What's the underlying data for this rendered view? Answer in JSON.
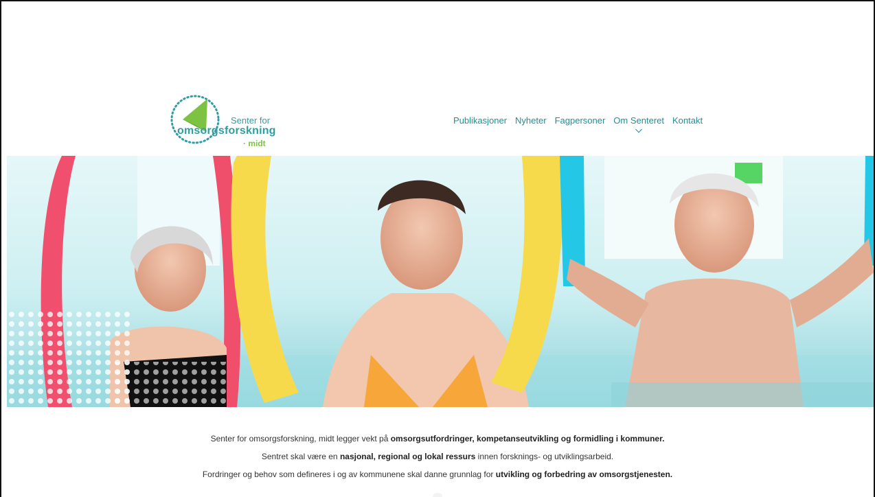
{
  "logo": {
    "line1": "Senter for",
    "line2": "omsorgsforskning",
    "line3": "· midt",
    "icon": "green-kite-dotted-circle-logo"
  },
  "nav": {
    "items": [
      {
        "label": "Publikasjoner"
      },
      {
        "label": "Nyheter"
      },
      {
        "label": "Fagpersoner"
      },
      {
        "label": "Om Senteret"
      },
      {
        "label": "Kontakt"
      }
    ],
    "dropdown_icon": "chevron-down-icon"
  },
  "hero": {
    "image": "three people holding pool noodles in a swimming pool"
  },
  "intro": {
    "line1_pre": "Senter for omsorgsforskning, midt legger vekt på ",
    "line1_bold": "omsorgsutfordringer, kompetanseutvikling og formidling i kommuner.",
    "line2_pre": "Sentret skal være en ",
    "line2_bold": "nasjonal, regional og lokal ressurs",
    "line2_post": " innen forsknings- og utviklingsarbeid.",
    "line3_pre": "Fordringer og behov som defineres i og av kommunene skal danne grunnlag for ",
    "line3_bold": "utvikling og forbedring av omsorgstjenesten."
  },
  "colors": {
    "brand_teal": "#2f9ea3",
    "brand_green": "#7dc242",
    "nav_text": "#1f8f96"
  }
}
